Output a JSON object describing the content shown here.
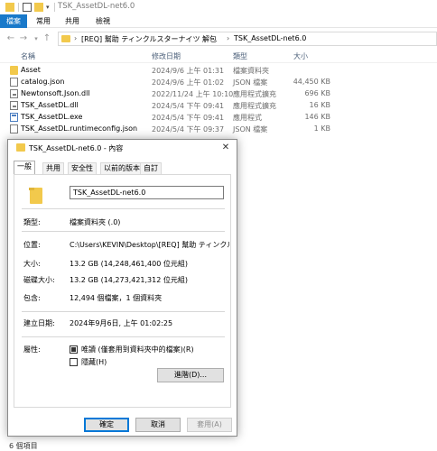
{
  "window": {
    "title": "TSK_AssetDL-net6.0",
    "ribbon_tabs": [
      "檔案",
      "常用",
      "共用",
      "檢視"
    ],
    "address_segments": [
      "[REQ] 幫助 ティンクルスターナイツ 解包",
      "TSK_AssetDL-net6.0"
    ]
  },
  "columns": {
    "name": "名稱",
    "date": "修改日期",
    "type": "類型",
    "size": "大小"
  },
  "files": [
    {
      "name": "Asset",
      "date": "2024/9/6 上午 01:31",
      "type": "檔案資料夾",
      "size": "",
      "icon": "folder-icon"
    },
    {
      "name": "catalog.json",
      "date": "2024/9/6 上午 01:02",
      "type": "JSON 檔案",
      "size": "44,450 KB",
      "icon": "json-file-icon"
    },
    {
      "name": "Newtonsoft.Json.dll",
      "date": "2022/11/24 上午 10:10",
      "type": "應用程式擴充",
      "size": "696 KB",
      "icon": "dll-file-icon"
    },
    {
      "name": "TSK_AssetDL.dll",
      "date": "2024/5/4 下午 09:41",
      "type": "應用程式擴充",
      "size": "16 KB",
      "icon": "dll-file-icon"
    },
    {
      "name": "TSK_AssetDL.exe",
      "date": "2024/5/4 下午 09:41",
      "type": "應用程式",
      "size": "146 KB",
      "icon": "exe-file-icon"
    },
    {
      "name": "TSK_AssetDL.runtimeconfig.json",
      "date": "2024/5/4 下午 09:37",
      "type": "JSON 檔案",
      "size": "1 KB",
      "icon": "json-file-icon"
    }
  ],
  "status": {
    "item_count": "6 個項目"
  },
  "dialog": {
    "title": "TSK_AssetDL-net6.0 - 內容",
    "close_glyph": "✕",
    "tabs": [
      "一般",
      "共用",
      "安全性",
      "以前的版本",
      "自訂"
    ],
    "folder_name": "TSK_AssetDL-net6.0",
    "props": [
      {
        "label": "類型:",
        "value": "檔案資料夾 (.0)"
      },
      {
        "label": "位置:",
        "value": "C:\\Users\\KEVIN\\Desktop\\[REQ] 幫助 ティンクルスタ"
      },
      {
        "label": "大小:",
        "value": "13.2 GB (14,248,461,400 位元組)"
      },
      {
        "label": "磁碟大小:",
        "value": "13.2 GB (14,273,421,312 位元組)"
      },
      {
        "label": "包含:",
        "value": "12,494 個檔案，1 個資料夾"
      }
    ],
    "created": {
      "label": "建立日期:",
      "value": "2024年9月6日, 上午 01:02:25"
    },
    "attributes": {
      "label": "屬性:",
      "readonly": "唯讀 (僅套用到資料夾中的檔案)(R)",
      "hidden": "隱藏(H)",
      "advanced": "進階(D)..."
    },
    "buttons": {
      "ok": "確定",
      "cancel": "取消",
      "apply": "套用(A)"
    }
  }
}
